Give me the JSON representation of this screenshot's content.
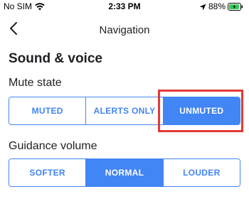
{
  "status_bar": {
    "carrier": "No SIM",
    "time": "2:33 PM",
    "battery": "88%",
    "icons": [
      "wifi-icon",
      "location-arrow-icon",
      "battery-charging-icon"
    ]
  },
  "header": {
    "back_icon": "chevron-left-icon",
    "title": "Navigation"
  },
  "section": {
    "title": "Sound & voice"
  },
  "mute_state": {
    "label": "Mute state",
    "options": [
      "MUTED",
      "ALERTS ONLY",
      "UNMUTED"
    ],
    "selected": "UNMUTED"
  },
  "guidance_volume": {
    "label": "Guidance volume",
    "options": [
      "SOFTER",
      "NORMAL",
      "LOUDER"
    ],
    "selected": "NORMAL"
  },
  "colors": {
    "accent": "#4285f4",
    "highlight": "#e53935",
    "battery": "#34c759"
  }
}
